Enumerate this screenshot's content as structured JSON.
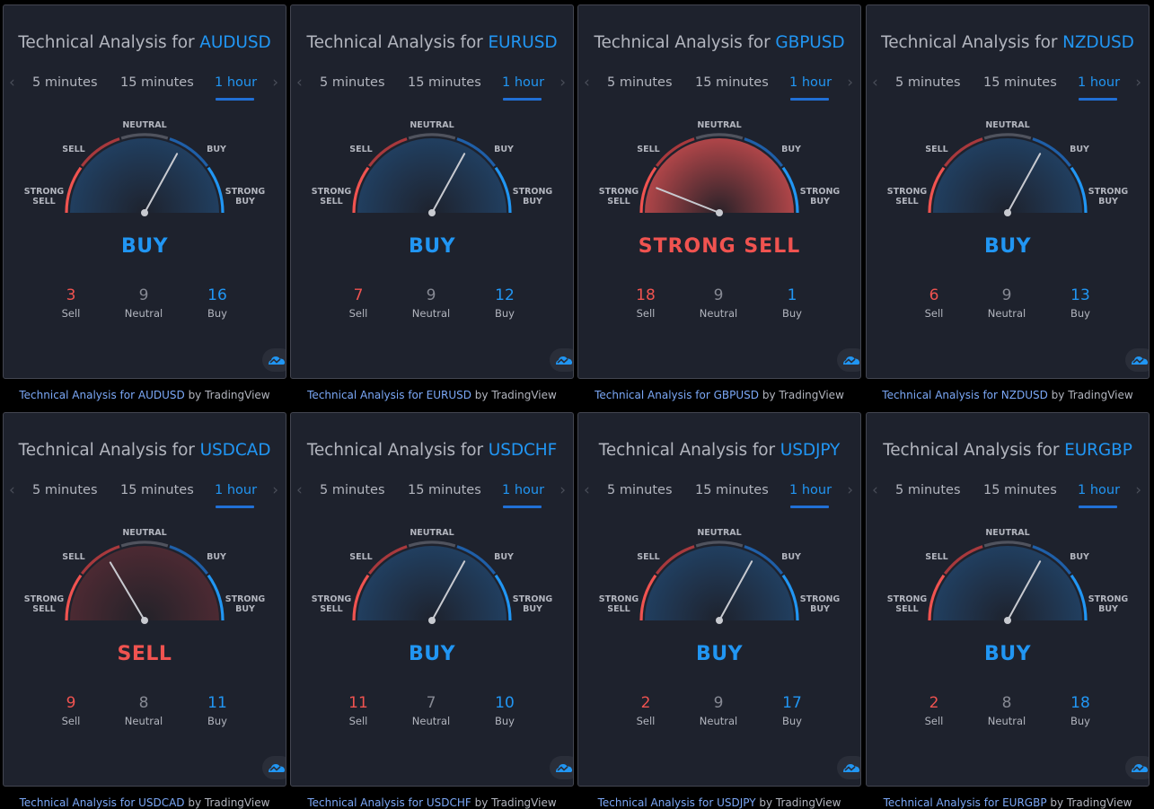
{
  "common": {
    "title_prefix": "Technical Analysis for ",
    "tabs": [
      "5 minutes",
      "15 minutes",
      "1 hour"
    ],
    "active_tab": "1 hour",
    "prev_arrow": "‹",
    "next_arrow": "›",
    "gauge_labels": {
      "strong_sell": [
        "STRONG",
        "SELL"
      ],
      "sell": "SELL",
      "neutral": "NEUTRAL",
      "buy": "BUY",
      "strong_buy": [
        "STRONG",
        "BUY"
      ]
    },
    "count_labels": {
      "sell": "Sell",
      "neutral": "Neutral",
      "buy": "Buy"
    },
    "footer_link_prefix": "Technical Analysis for ",
    "footer_suffix": " by TradingView",
    "logo_icon": "tradingview-cloud-icon"
  },
  "colors": {
    "buy": "#2196f3",
    "sell": "#f05350",
    "neutral": "#868993",
    "card_bg": "#1e222d",
    "page_bg": "#000000"
  },
  "widgets": [
    {
      "symbol": "AUDUSD",
      "signal": "BUY",
      "signal_type": "buy",
      "sell": 3,
      "neutral": 9,
      "buy": 16,
      "needle": 0.66
    },
    {
      "symbol": "EURUSD",
      "signal": "BUY",
      "signal_type": "buy",
      "sell": 7,
      "neutral": 9,
      "buy": 12,
      "needle": 0.66
    },
    {
      "symbol": "GBPUSD",
      "signal": "STRONG SELL",
      "signal_type": "sell",
      "sell": 18,
      "neutral": 9,
      "buy": 1,
      "needle": 0.12
    },
    {
      "symbol": "NZDUSD",
      "signal": "BUY",
      "signal_type": "buy",
      "sell": 6,
      "neutral": 9,
      "buy": 13,
      "needle": 0.66
    },
    {
      "symbol": "USDCAD",
      "signal": "SELL",
      "signal_type": "sell",
      "sell": 9,
      "neutral": 8,
      "buy": 11,
      "needle": 0.33
    },
    {
      "symbol": "USDCHF",
      "signal": "BUY",
      "signal_type": "buy",
      "sell": 11,
      "neutral": 7,
      "buy": 10,
      "needle": 0.66
    },
    {
      "symbol": "USDJPY",
      "signal": "BUY",
      "signal_type": "buy",
      "sell": 2,
      "neutral": 9,
      "buy": 17,
      "needle": 0.66
    },
    {
      "symbol": "EURGBP",
      "signal": "BUY",
      "signal_type": "buy",
      "sell": 2,
      "neutral": 8,
      "buy": 18,
      "needle": 0.66
    }
  ]
}
